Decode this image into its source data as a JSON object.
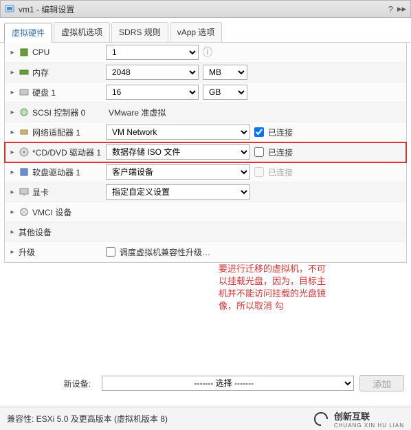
{
  "title": "vm1 - 编辑设置",
  "tabs": [
    {
      "label": "虚拟硬件",
      "active": true
    },
    {
      "label": "虚拟机选项",
      "active": false
    },
    {
      "label": "SDRS 规则",
      "active": false
    },
    {
      "label": "vApp 选项",
      "active": false
    }
  ],
  "rows": {
    "cpu": {
      "label": "CPU",
      "value": "1"
    },
    "memory": {
      "label": "内存",
      "value": "2048",
      "unit": "MB"
    },
    "disk": {
      "label": "硬盘 1",
      "value": "16",
      "unit": "GB"
    },
    "scsi": {
      "label": "SCSI 控制器 0",
      "value": "VMware 准虚拟"
    },
    "net": {
      "label": "网络适配器 1",
      "value": "VM Network",
      "connected_label": "已连接",
      "connected": true
    },
    "cd": {
      "label": "*CD/DVD 驱动器 1",
      "value": "数据存储 ISO 文件",
      "connected_label": "已连接",
      "connected": false
    },
    "floppy": {
      "label": "软盘驱动器 1",
      "value": "客户端设备",
      "connected_label": "已连接",
      "connected": false,
      "disabled": true
    },
    "video": {
      "label": "显卡",
      "value": "指定自定义设置"
    },
    "vmci": {
      "label": "VMCI 设备"
    },
    "other": {
      "label": "其他设备"
    },
    "upgrade": {
      "label": "升级",
      "checkbox_label": "调度虚拟机兼容性升级…"
    }
  },
  "annotation": "要进行迁移的虚拟机，不可以挂载光盘，因为，目标主机并不能访问挂载的光盘镜像，所以取消   勾",
  "new_device": {
    "label": "新设备:",
    "select": "------- 选择 -------",
    "add": "添加"
  },
  "footer": {
    "compat": "兼容性: ESXi 5.0 及更高版本 (虚拟机版本 8)"
  },
  "brand": {
    "name": "创新互联",
    "sub": "CHUANG XIN HU LIAN"
  }
}
